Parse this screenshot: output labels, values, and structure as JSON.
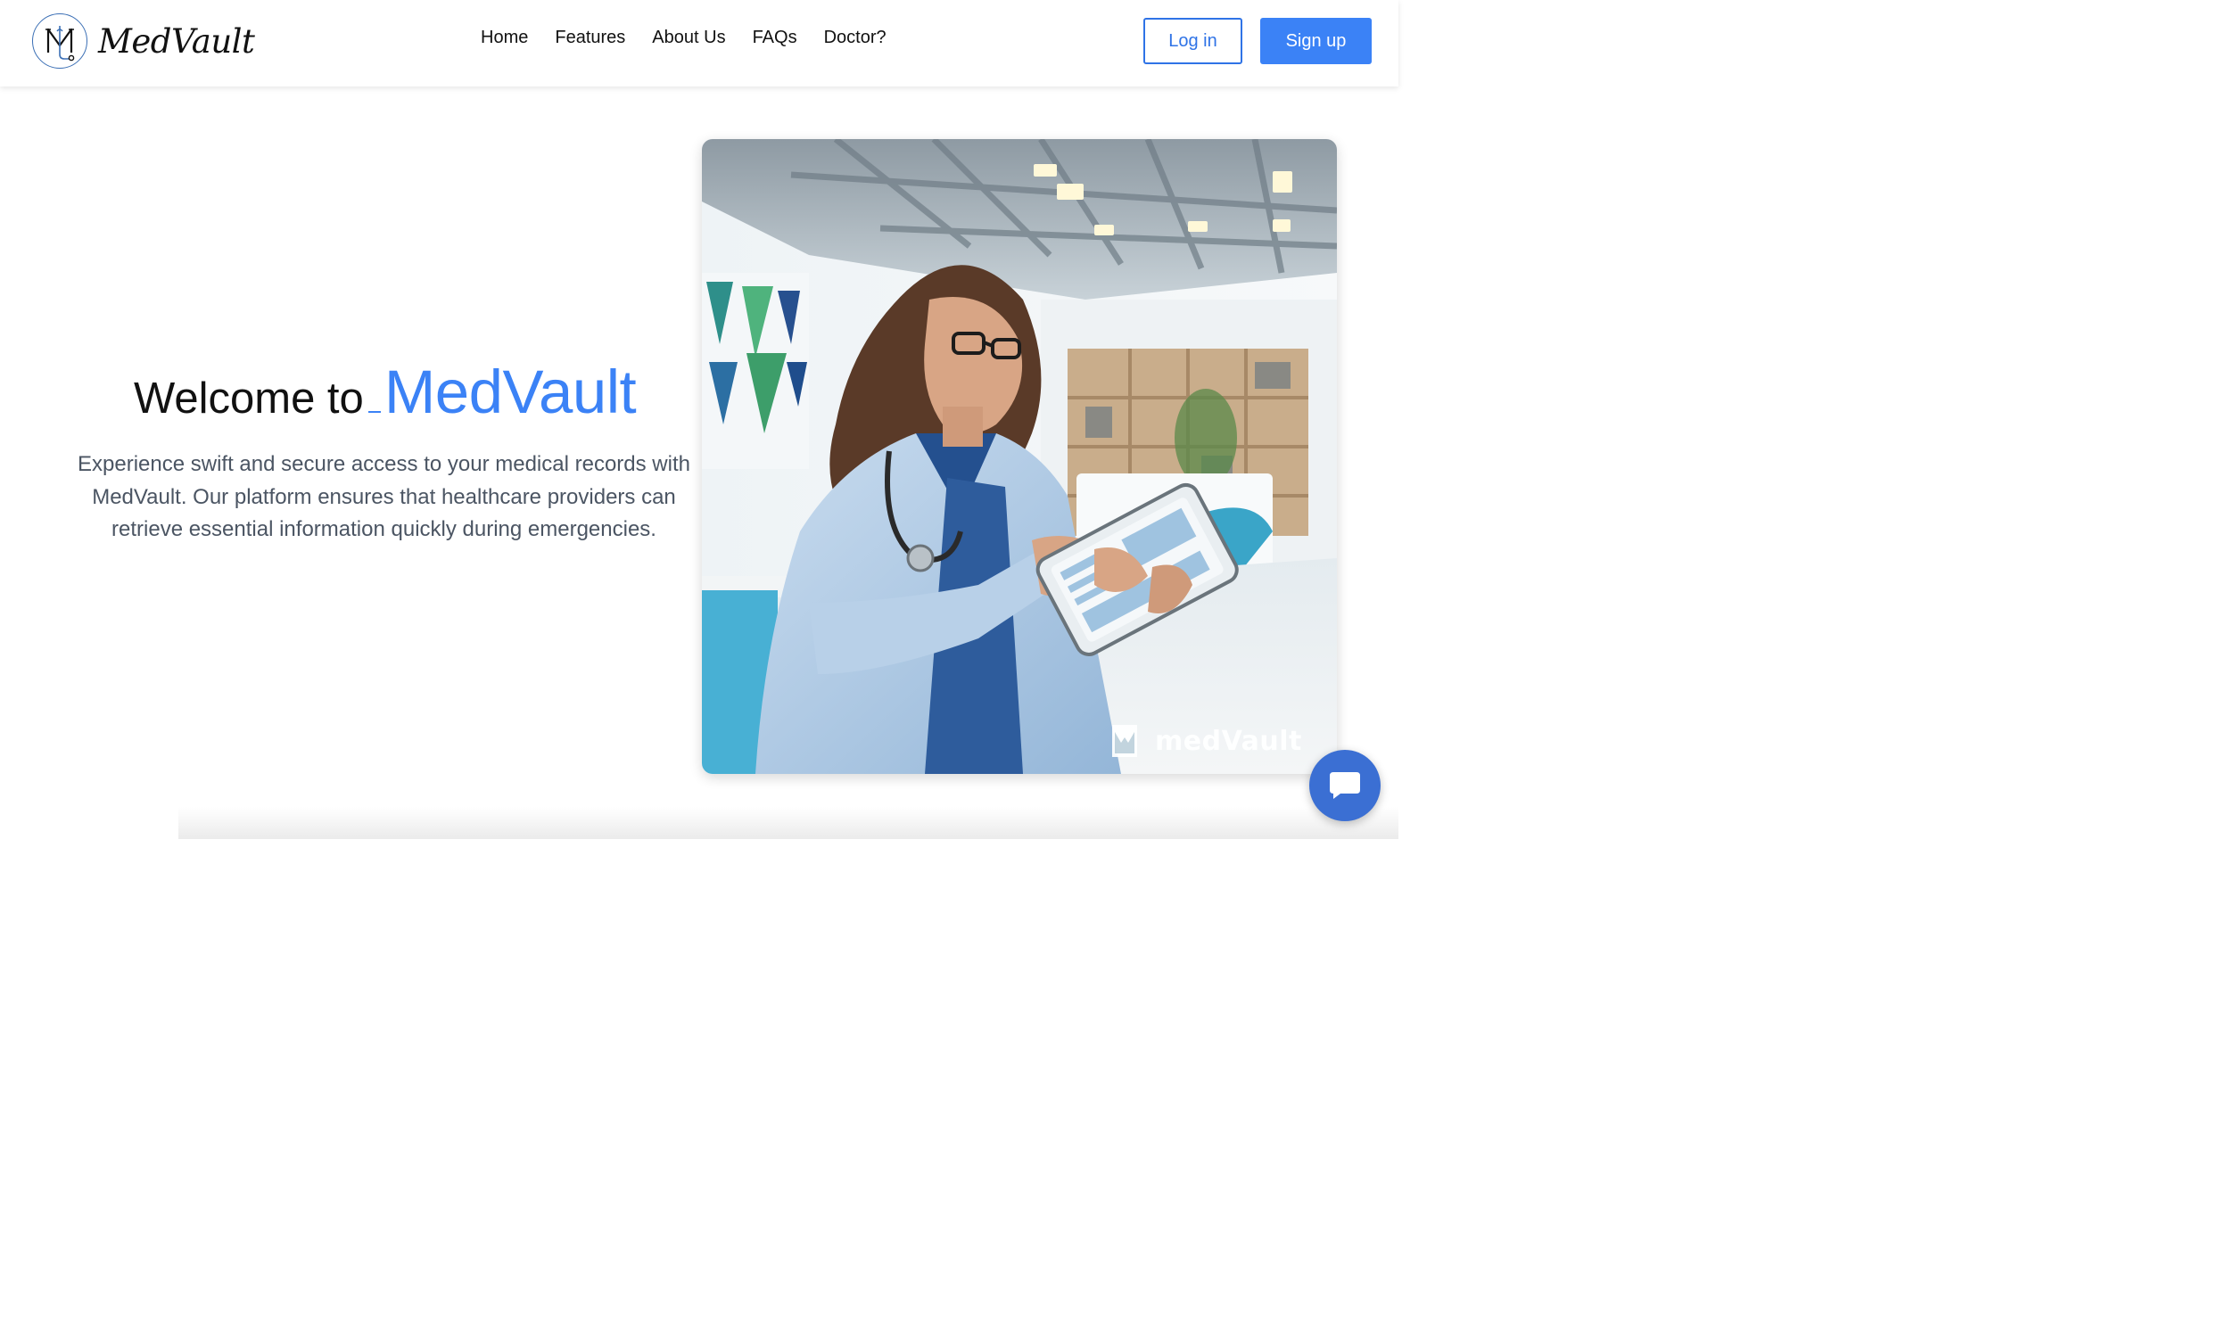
{
  "header": {
    "brand_name": "MedVault",
    "logo_icon": "medvault-stethoscope-logo",
    "nav": [
      {
        "label": "Home"
      },
      {
        "label": "Features"
      },
      {
        "label": "About Us"
      },
      {
        "label": "FAQs"
      },
      {
        "label": "Doctor?"
      }
    ],
    "login_label": "Log in",
    "signup_label": "Sign up"
  },
  "hero": {
    "welcome": "Welcome to",
    "brand": "MedVault",
    "description": "Experience swift and secure access to your medical records with MedVault. Our platform ensures that healthcare providers can retrieve essential information quickly during emergencies.",
    "image": {
      "subject": "doctor-using-tablet-in-clinic",
      "watermark_text": "medVault",
      "watermark_icon": "medvault-mark-icon"
    }
  },
  "chat": {
    "icon": "chat-bubble-icon"
  },
  "colors": {
    "accent": "#3b82f6",
    "login_border": "#2f73e6",
    "body_text": "#4b5563",
    "chat_button": "#3b6fd3"
  }
}
